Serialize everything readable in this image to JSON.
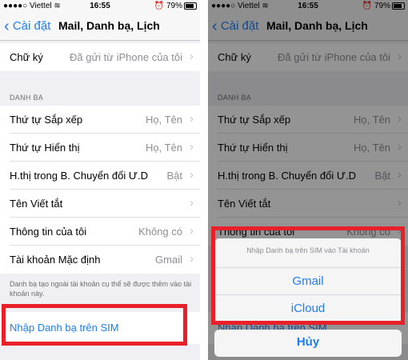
{
  "status": {
    "carrier": "Viettel",
    "time": "16:55",
    "battery": "79%"
  },
  "nav": {
    "back_label": "Cài đặt",
    "title": "Mail, Danh bạ, Lịch"
  },
  "signature": {
    "label": "Chữ ký",
    "value": "Đã gửi từ iPhone của tôi"
  },
  "contacts_header": "DANH BẠ",
  "rows": [
    {
      "label": "Thứ tự Sắp xếp",
      "value": "Họ, Tên"
    },
    {
      "label": "Thứ tự Hiển thị",
      "value": "Họ, Tên"
    },
    {
      "label": "H.thị trong B. Chuyển đổi Ư.D",
      "value": "Bật"
    },
    {
      "label": "Tên Viết tắt",
      "value": ""
    },
    {
      "label": "Thông tin của tôi",
      "value": "Không có"
    },
    {
      "label": "Tài khoản Mặc định",
      "value": "Gmail"
    }
  ],
  "footnote": "Danh bạ tạo ngoài tài khoản cụ thể sẽ được thêm vào tài khoản này.",
  "import_sim": "Nhập Danh bạ trên SIM",
  "sheet": {
    "title": "Nhập Danh bạ trên SIM vào Tài khoản",
    "options": [
      "Gmail",
      "iCloud"
    ],
    "cancel": "Hủy"
  },
  "colors": {
    "accent": "#1f7cf6",
    "highlight": "#e8202a"
  }
}
